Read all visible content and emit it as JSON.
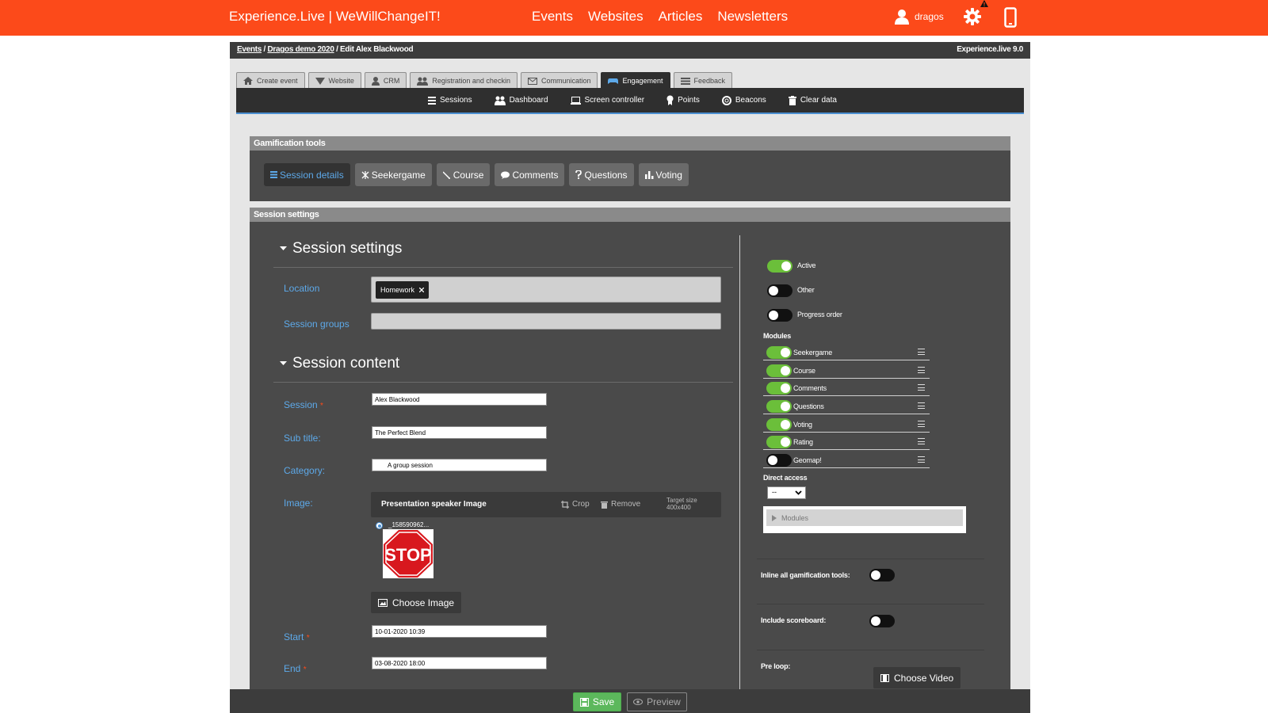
{
  "header": {
    "brand": "Experience.Live | WeWillChangeIT!",
    "nav": [
      "Events",
      "Websites",
      "Articles",
      "Newsletters"
    ],
    "username": "dragos",
    "accent_color": "#fc4a1a"
  },
  "breadcrumb": {
    "events": "Events",
    "sep": "/",
    "event": "Dragos demo 2020",
    "current": "Edit Alex Blackwood",
    "version": "Experience.live 9.0"
  },
  "tabs": [
    {
      "label": "Create event",
      "icon": "home-icon"
    },
    {
      "label": "Website",
      "icon": "globe-icon"
    },
    {
      "label": "CRM",
      "icon": "user-icon"
    },
    {
      "label": "Registration and checkin",
      "icon": "users-icon"
    },
    {
      "label": "Communication",
      "icon": "envelope-icon"
    },
    {
      "label": "Engagement",
      "icon": "gamepad-icon",
      "active": true
    },
    {
      "label": "Feedback",
      "icon": "list-icon"
    }
  ],
  "subnav": [
    {
      "label": "Sessions",
      "icon": "list-icon"
    },
    {
      "label": "Dashboard",
      "icon": "users-icon"
    },
    {
      "label": "Screen controller",
      "icon": "laptop-icon"
    },
    {
      "label": "Points",
      "icon": "award-icon"
    },
    {
      "label": "Beacons",
      "icon": "lifebuoy-icon"
    },
    {
      "label": "Clear data",
      "icon": "trash-icon"
    }
  ],
  "gamification": {
    "title": "Gamification tools",
    "buttons": [
      {
        "label": "Session details",
        "active": true
      },
      {
        "label": "Seekergame"
      },
      {
        "label": "Course"
      },
      {
        "label": "Comments"
      },
      {
        "label": "Questions"
      },
      {
        "label": "Voting"
      }
    ]
  },
  "session": {
    "panel_title": "Session settings",
    "settings_title": "Session settings",
    "content_title": "Session content",
    "location_label": "Location",
    "location_tag": "Homework",
    "groups_label": "Session groups",
    "session_label": "Session",
    "session_value": "Alex Blackwood",
    "subtitle_label": "Sub title:",
    "subtitle_value": "The Perfect Blend",
    "category_label": "Category:",
    "category_value": "A group session",
    "image_label": "Image:",
    "image_title": "Presentation speaker Image",
    "crop_label": "Crop",
    "remove_label": "Remove",
    "target_label": "Target size",
    "target_value": "400x400",
    "image_filename": "_158590962...",
    "image_text": "STOP",
    "choose_image": "Choose Image",
    "start_label": "Start",
    "start_value": "10-01-2020 10:39",
    "end_label": "End",
    "end_value": "03-08-2020 18:00",
    "required_mark": "*"
  },
  "right": {
    "toggles": [
      {
        "label": "Active",
        "on": true
      },
      {
        "label": "Other",
        "on": false
      },
      {
        "label": "Progress order",
        "on": false
      }
    ],
    "modules_title": "Modules",
    "modules": [
      {
        "label": "Seekergame",
        "on": true
      },
      {
        "label": "Course",
        "on": true
      },
      {
        "label": "Comments",
        "on": true
      },
      {
        "label": "Questions",
        "on": true
      },
      {
        "label": "Voting",
        "on": true
      },
      {
        "label": "Rating",
        "on": true
      },
      {
        "label": "Geomap!",
        "on": false
      }
    ],
    "direct_access_label": "Direct access",
    "direct_access_value": "--",
    "modules_collapsed": "Modules",
    "inline_label": "Inline all gamification tools:",
    "inline_on": false,
    "scoreboard_label": "Include scoreboard:",
    "scoreboard_on": false,
    "preloop_label": "Pre loop:",
    "choose_video": "Choose Video"
  },
  "footer": {
    "save": "Save",
    "preview": "Preview",
    "save_color": "#5cb85c"
  }
}
